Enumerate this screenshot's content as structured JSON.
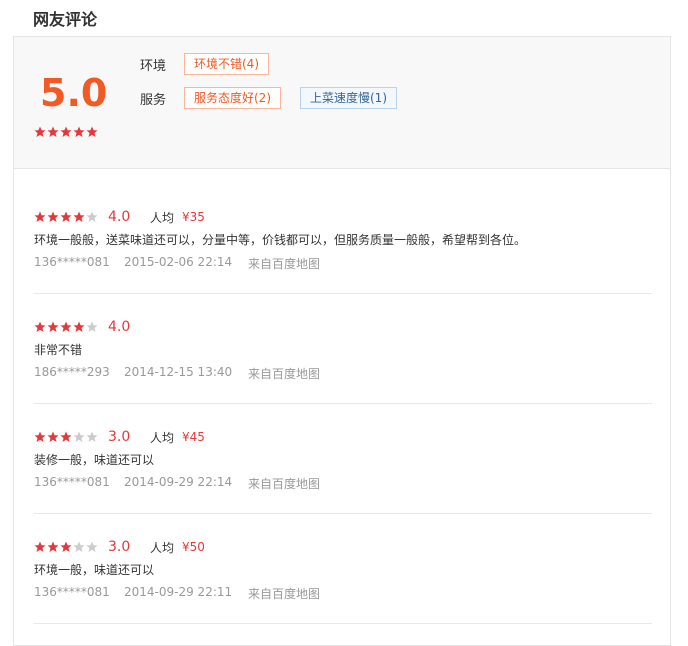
{
  "page": {
    "title": "网友评论"
  },
  "summary": {
    "score": "5.0",
    "stars": 5,
    "categories": [
      {
        "label": "环境",
        "tags": [
          {
            "text": "环境不错(4)",
            "kind": "pos"
          }
        ]
      },
      {
        "label": "服务",
        "tags": [
          {
            "text": "服务态度好(2)",
            "kind": "pos"
          },
          {
            "text": "上菜速度慢(1)",
            "kind": "neg"
          }
        ]
      }
    ]
  },
  "colors": {
    "accent": "#f15a24",
    "star_on": "#e4393c",
    "star_off": "#cccccc",
    "negative_tag": "#336699"
  },
  "reviews": [
    {
      "stars": 4,
      "score": "4.0",
      "avg_label": "人均",
      "avg_price": "¥35",
      "text": "环境一般般，送菜味道还可以，分量中等，价钱都可以，但服务质量一般般，希望帮到各位。",
      "user": "136*****081",
      "time": "2015-02-06 22:14",
      "source": "来自百度地图"
    },
    {
      "stars": 4,
      "score": "4.0",
      "avg_label": "",
      "avg_price": "",
      "text": "非常不错",
      "user": "186*****293",
      "time": "2014-12-15 13:40",
      "source": "来自百度地图"
    },
    {
      "stars": 3,
      "score": "3.0",
      "avg_label": "人均",
      "avg_price": "¥45",
      "text": "装修一般，味道还可以",
      "user": "136*****081",
      "time": "2014-09-29 22:14",
      "source": "来自百度地图"
    },
    {
      "stars": 3,
      "score": "3.0",
      "avg_label": "人均",
      "avg_price": "¥50",
      "text": "环境一般，味道还可以",
      "user": "136*****081",
      "time": "2014-09-29 22:11",
      "source": "来自百度地图"
    }
  ]
}
